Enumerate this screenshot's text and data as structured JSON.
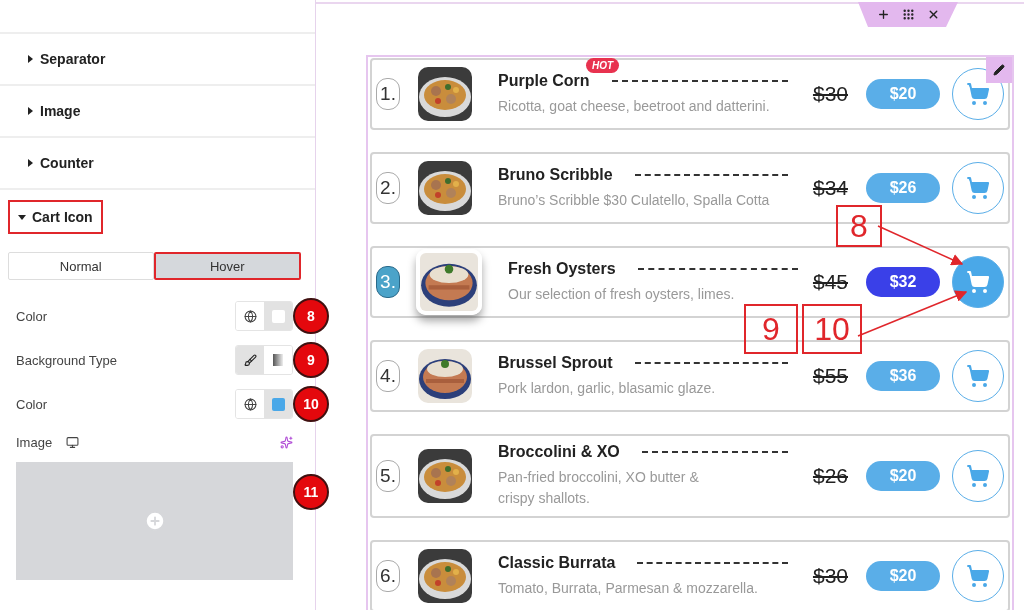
{
  "panel": {
    "sections": [
      {
        "title": "Separator",
        "expanded": false,
        "highlighted": false
      },
      {
        "title": "Image",
        "expanded": false,
        "highlighted": false
      },
      {
        "title": "Counter",
        "expanded": false,
        "highlighted": false
      },
      {
        "title": "Cart Icon",
        "expanded": true,
        "highlighted": true
      }
    ],
    "state_tabs": [
      {
        "label": "Normal",
        "selected": false,
        "highlighted": false
      },
      {
        "label": "Hover",
        "selected": true,
        "highlighted": true
      }
    ],
    "controls": [
      {
        "kind": "color",
        "label": "Color",
        "color": "#ffffff",
        "callout": "8"
      },
      {
        "kind": "background_type",
        "label": "Background Type",
        "callout": "9",
        "options": [
          {
            "kind": "classic",
            "selected": true
          },
          {
            "kind": "gradient",
            "selected": false
          }
        ]
      },
      {
        "kind": "color",
        "label": "Color",
        "color": "#4aa8e8",
        "callout": "10"
      },
      {
        "label": "Image",
        "callout": "11"
      }
    ]
  },
  "menu": {
    "items": [
      {
        "number": "1.",
        "name": "Purple Corn",
        "badge": "HOT",
        "description": "Ricotta, goat cheese, beetroot and datterini.",
        "old_price": "$30",
        "price": "$20",
        "hovered": false
      },
      {
        "number": "2.",
        "name": "Bruno Scribble",
        "description": "Bruno’s Scribble $30 Culatello, Spalla Cotta",
        "old_price": "$34",
        "price": "$26",
        "hovered": false
      },
      {
        "number": "3.",
        "name": "Fresh Oysters",
        "description": "Our selection of fresh oysters, limes.",
        "old_price": "$45",
        "price": "$32",
        "hovered": true
      },
      {
        "number": "4.",
        "name": "Brussel Sprout",
        "description": "Pork lardon, garlic, blasamic glaze.",
        "old_price": "$55",
        "price": "$36",
        "hovered": false
      },
      {
        "number": "5.",
        "name": "Broccolini & XO",
        "description": "Pan-fried broccolini, XO butter &\ncrispy shallots.",
        "old_price": "$26",
        "price": "$20",
        "hovered": false
      },
      {
        "number": "6.",
        "name": "Classic Burrata",
        "description": "Tomato, Burrata, Parmesan & mozzarella.",
        "old_price": "$30",
        "price": "$20",
        "hovered": false
      }
    ]
  },
  "callouts": [
    {
      "number": "8"
    },
    {
      "number": "9"
    },
    {
      "number": "10"
    }
  ]
}
